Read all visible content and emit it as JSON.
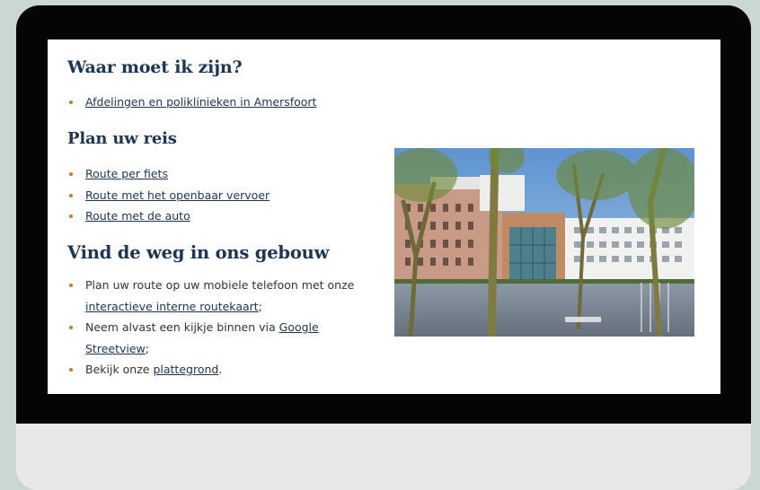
{
  "sections": {
    "where": {
      "heading": "Waar moet ik zijn?",
      "link": "Afdelingen en poliklinieken in Amersfoort"
    },
    "plan": {
      "heading": "Plan uw reis",
      "links": [
        "Route per fiets",
        "Route met het openbaar vervoer",
        "Route met de auto"
      ]
    },
    "find": {
      "heading": "Vind de weg in ons gebouw",
      "item1_text": "Plan uw route op uw mobiele telefoon met onze ",
      "item1_link": "interactieve interne routekaart",
      "item1_suffix": ";",
      "item2_text": "Neem alvast een kijkje binnen via ",
      "item2_link": "Google Streetview",
      "item2_suffix": ";",
      "item3_text": "Bekijk onze ",
      "item3_link": "plattegrond",
      "item3_suffix": "."
    }
  },
  "colors": {
    "heading": "#1c3553",
    "bullet": "#c07a2a",
    "background": "#c9d8d1"
  },
  "image": {
    "subject": "hospital-building-photo"
  }
}
